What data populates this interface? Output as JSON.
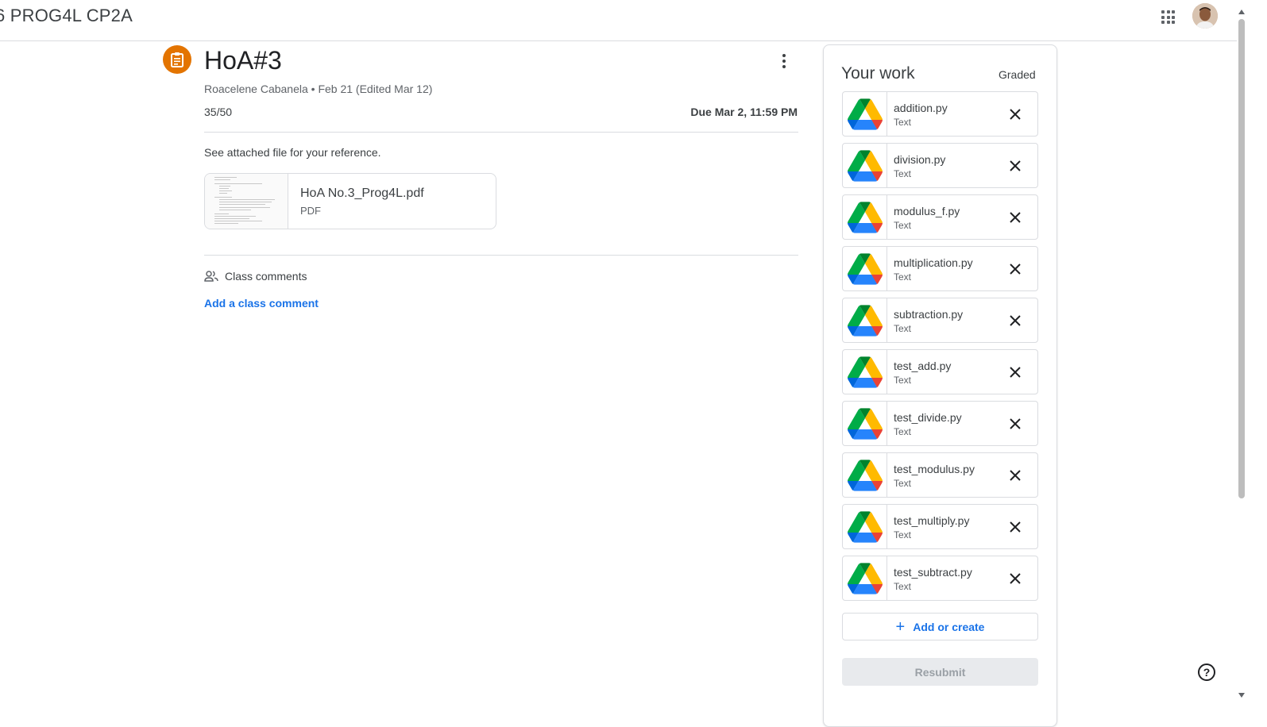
{
  "header": {
    "course_title": "6 PROG4L CP2A",
    "apps_icon": "google-apps-icon",
    "avatar_icon": "user-avatar"
  },
  "assignment": {
    "icon": "assignment-icon",
    "title": "HoA#3",
    "meta": "Roacelene Cabanela • Feb 21 (Edited Mar 12)",
    "points": "35/50",
    "due": "Due Mar 2, 11:59 PM",
    "instructions": "See attached file for your reference.",
    "attachment": {
      "name": "HoA No.3_Prog4L.pdf",
      "type": "PDF"
    }
  },
  "comments": {
    "label": "Class comments",
    "add_label": "Add a class comment"
  },
  "work": {
    "title": "Your work",
    "status": "Graded",
    "files": [
      {
        "name": "addition.py",
        "type": "Text"
      },
      {
        "name": "division.py",
        "type": "Text"
      },
      {
        "name": "modulus_f.py",
        "type": "Text"
      },
      {
        "name": "multiplication.py",
        "type": "Text"
      },
      {
        "name": "subtraction.py",
        "type": "Text"
      },
      {
        "name": "test_add.py",
        "type": "Text"
      },
      {
        "name": "test_divide.py",
        "type": "Text"
      },
      {
        "name": "test_modulus.py",
        "type": "Text"
      },
      {
        "name": "test_multiply.py",
        "type": "Text"
      },
      {
        "name": "test_subtract.py",
        "type": "Text"
      }
    ],
    "add_create_label": "Add or create",
    "resubmit_label": "Resubmit"
  },
  "help": {
    "label": "?"
  },
  "colors": {
    "accent": "#1a73e8",
    "assignment_orange": "#e37400",
    "border": "#dadce0"
  }
}
